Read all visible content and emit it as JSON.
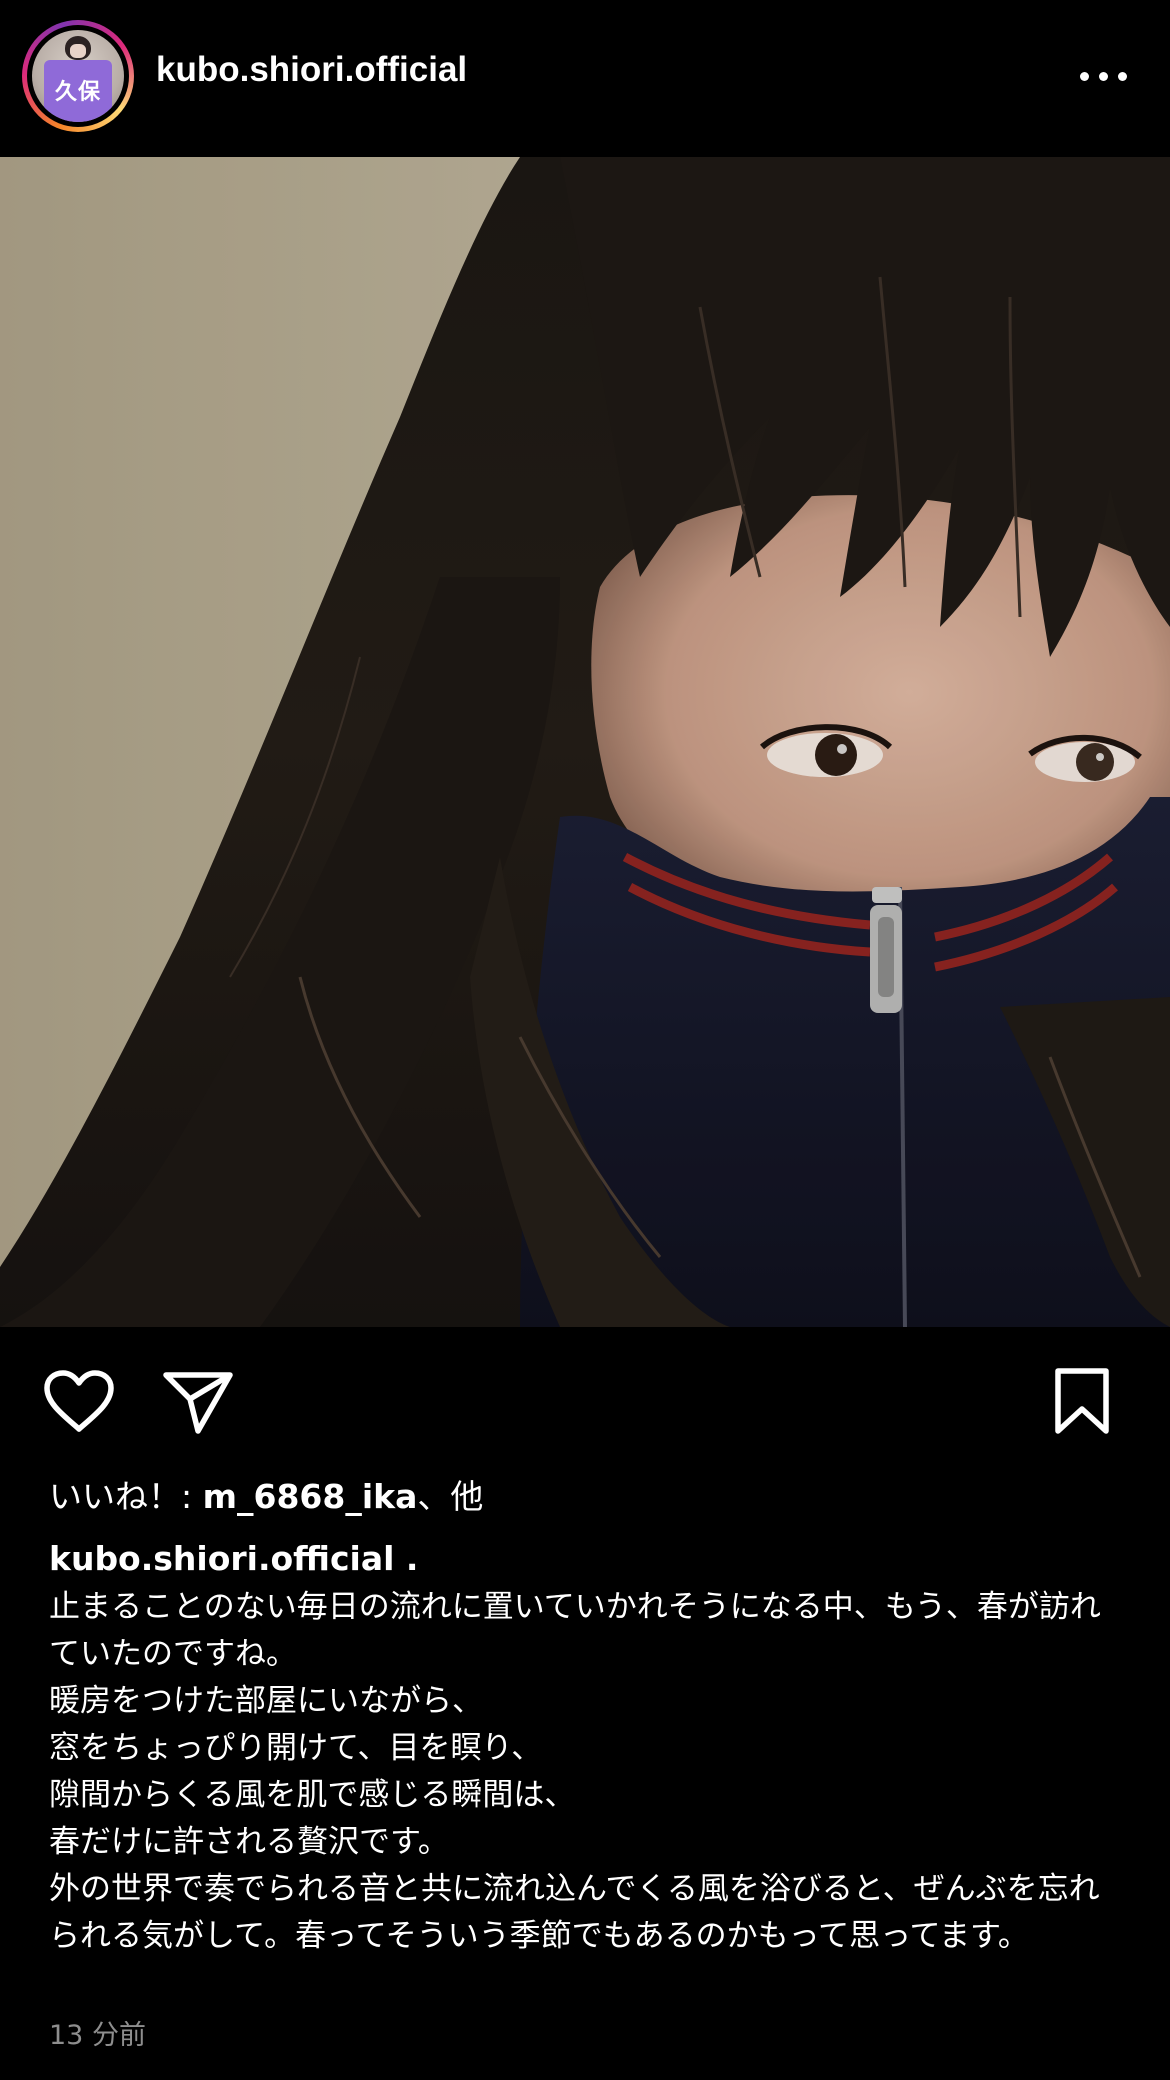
{
  "post": {
    "username": "kubo.shiori.official",
    "avatar_shirt_text": "久保",
    "more_icon": "more-horizontal-icon"
  },
  "photo": {
    "subject": "photo"
  },
  "actions": {
    "like_icon": "heart-icon",
    "share_icon": "send-icon",
    "save_icon": "bookmark-icon"
  },
  "likes": {
    "prefix": "いいね！: ",
    "user": "m_6868_ika",
    "suffix": "、他"
  },
  "caption": {
    "user": "kubo.shiori.official",
    "user_suffix": " .",
    "paragraphs": [
      "止まることのない毎日の流れに置いていかれそうになる中、もう、春が訪れていたのですね。",
      "暖房をつけた部屋にいながら、",
      "窓をちょっぴり開けて、目を瞑り、",
      "隙間からくる風を肌で感じる瞬間は、",
      "春だけに許される贅沢です。",
      "外の世界で奏でられる音と共に流れ込んでくる風を浴びると、ぜんぶを忘れられる気がして。春ってそういう季節でもあるのかもって思ってます。"
    ]
  },
  "timestamp": "13 分前",
  "colors": {
    "background": "#000000",
    "text": "#ffffff",
    "muted": "#8e8e8e",
    "ring_start": "#f58529",
    "ring_end": "#dd2a7b"
  }
}
